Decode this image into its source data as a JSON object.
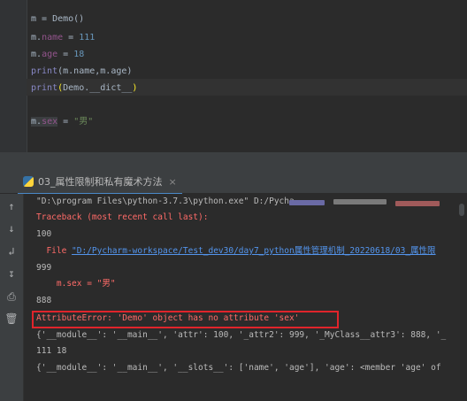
{
  "editor": {
    "lines": [
      {
        "text": "m = Demo()"
      },
      {
        "var": "m",
        "attr": "name",
        "op": " = ",
        "value": "111"
      },
      {
        "var": "m",
        "attr": "age",
        "op": " = ",
        "value": "18"
      },
      {
        "fn": "print",
        "args": "(m.name,m.age)"
      },
      {
        "fn": "print",
        "open": "(",
        "args": "Demo.__dict__",
        "close": ")"
      },
      {
        "var": "m",
        "attr": "sex",
        "op": " = ",
        "value": "\"男\""
      }
    ]
  },
  "tab": {
    "label": "03_属性限制和私有魔术方法",
    "close": "×"
  },
  "console": {
    "cmd": "\"D:\\program Files\\python-3.7.3\\python.exe\" D:/Pycha...",
    "traceback": "Traceback (most recent call last):",
    "out_100": "100",
    "file_prefix": "  File ",
    "file_link": "\"D:/Pycharm-workspace/Test_dev30/day7_python属性管理机制_20220618/03_属性限",
    "out_999": "999",
    "err_line": "    m.sex = \"男\"",
    "out_888": "888",
    "attr_error": "AttributeError: 'Demo' object has no attribute 'sex'",
    "dict1": "{'__module__': '__main__', 'attr': 100, '_attr2': 999, '_MyClass__attr3': 888, '_",
    "out_111_18": "111 18",
    "dict2": "{'__module__': '__main__', '__slots__': ['name', 'age'], 'age': <member 'age' of"
  },
  "tools": [
    "up-arrow-icon",
    "down-arrow-icon",
    "soft-wrap-icon",
    "scroll-end-icon",
    "print-icon",
    "trash-icon"
  ],
  "colors": {
    "background": "#2b2b2b",
    "error": "#ff6b68",
    "link": "#5394ec",
    "highlight_box": "#e0242b"
  }
}
